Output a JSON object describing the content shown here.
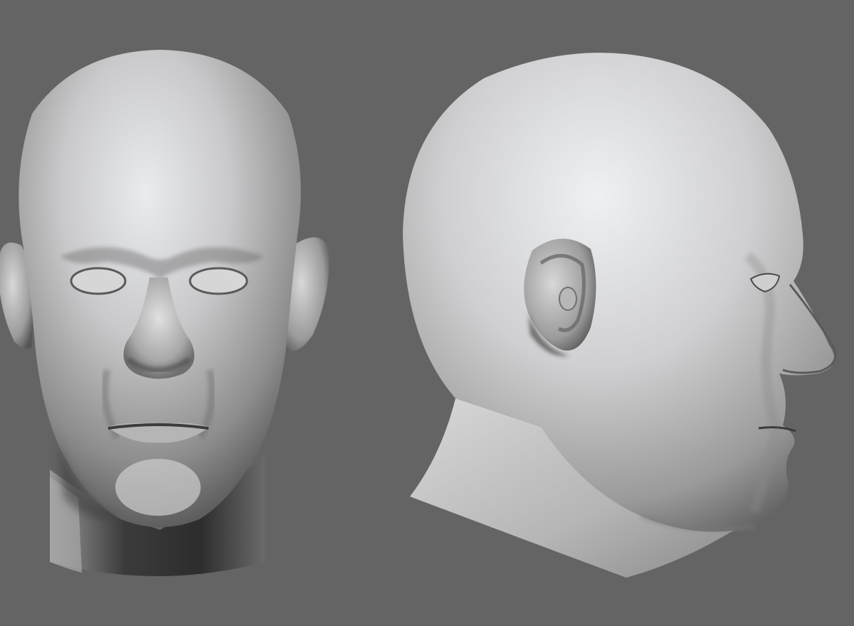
{
  "viewport": {
    "background_color": "#646464"
  },
  "models": [
    {
      "view": "front",
      "material": "clay-matcap",
      "base_color": "#bfbfbf"
    },
    {
      "view": "side",
      "material": "clay-matcap",
      "base_color": "#c4c4c4"
    }
  ]
}
